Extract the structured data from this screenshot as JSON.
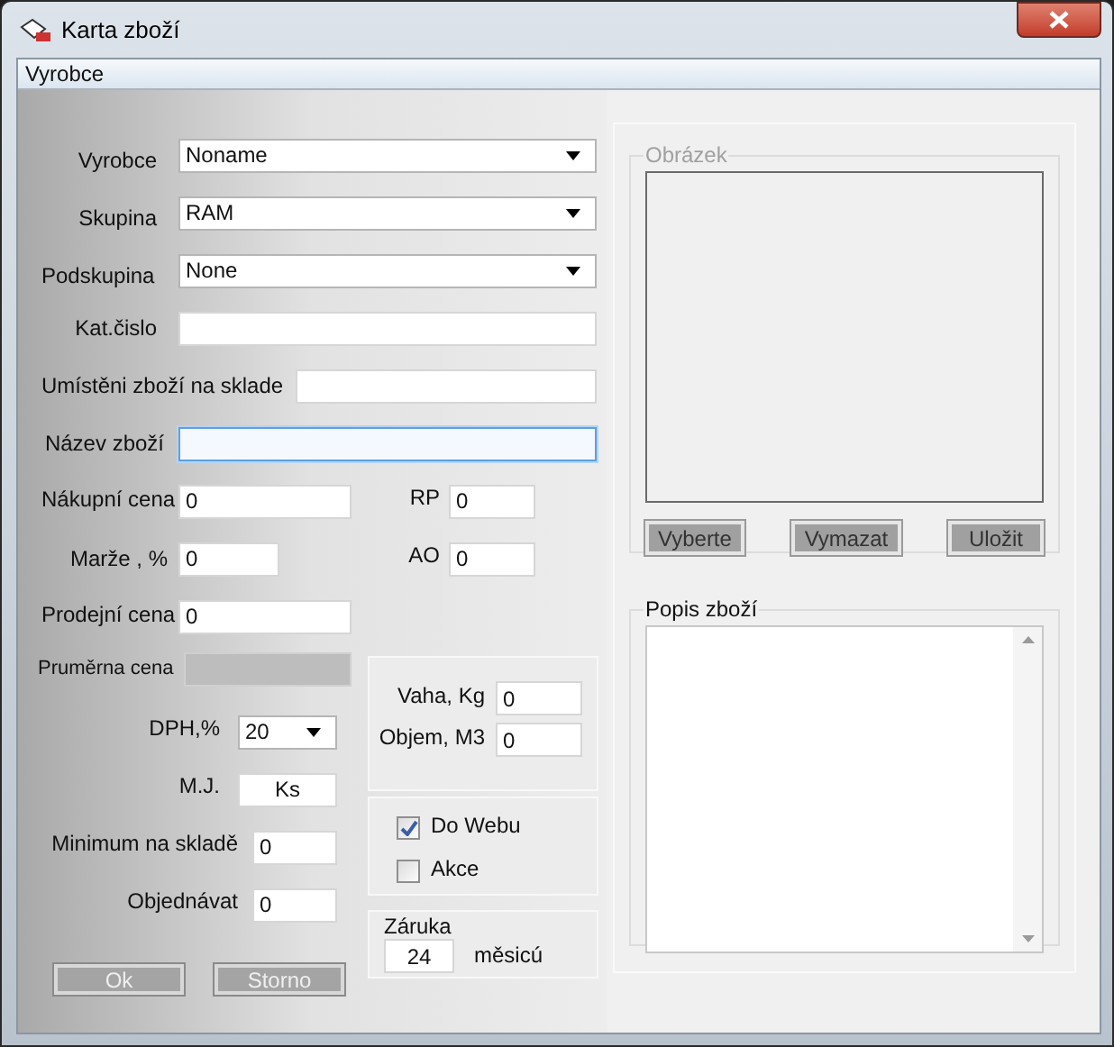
{
  "window": {
    "title": "Karta zboží"
  },
  "menu": [
    {
      "label": "Vyrobce"
    }
  ],
  "main_fields": [
    {
      "label": "Vyrobce",
      "kind": "combo",
      "value": "Noname"
    },
    {
      "label": "Skupina",
      "kind": "combo",
      "value": "RAM"
    },
    {
      "label": "Podskupina",
      "kind": "combo",
      "value": "None"
    },
    {
      "label": "Kat.čislo",
      "kind": "text",
      "focused": false,
      "disabled": false
    },
    {
      "label": "Umístěni zboží na sklade",
      "kind": "text",
      "focused": false,
      "disabled": false
    },
    {
      "label": "Název zboží",
      "kind": "text",
      "focused": true,
      "disabled": false
    },
    {
      "label": "Nákupní cena",
      "kind": "text",
      "value": "0",
      "focused": false,
      "disabled": false
    },
    {
      "label": "Marže , %",
      "kind": "text",
      "value": "0",
      "focused": false,
      "disabled": false
    },
    {
      "label": "Prodejní cena",
      "kind": "text",
      "value": "0",
      "focused": false,
      "disabled": false
    },
    {
      "label": "Pruměrna cena",
      "kind": "text",
      "focused": false,
      "disabled": true
    }
  ],
  "side_fields": [
    {
      "label": "RP",
      "value": "0"
    },
    {
      "label": "AO",
      "value": "0"
    }
  ],
  "lower_fields": [
    {
      "label": "DPH,%",
      "kind": "combo",
      "value": "20"
    },
    {
      "label": "M.J.",
      "kind": "text",
      "value": "Ks"
    },
    {
      "label": "Minimum na skladě",
      "kind": "text",
      "value": "0"
    },
    {
      "label": "Objednávat",
      "kind": "text",
      "value": "0"
    }
  ],
  "measures": [
    {
      "label": "Vaha, Kg",
      "value": "0"
    },
    {
      "label": "Objem, M3",
      "value": "0"
    }
  ],
  "checkboxes": [
    {
      "label": "Do Webu",
      "checked": true
    },
    {
      "label": "Akce",
      "checked": false
    }
  ],
  "warranty": {
    "label": "Záruka",
    "value": "24",
    "unit": "měsicú"
  },
  "buttons": [
    "Ok",
    "Storno"
  ],
  "image_panel": {
    "title": "Obrázek",
    "buttons": [
      "Vyberte",
      "Vymazat",
      "Uložit"
    ]
  },
  "description": {
    "title": "Popis zboží"
  }
}
